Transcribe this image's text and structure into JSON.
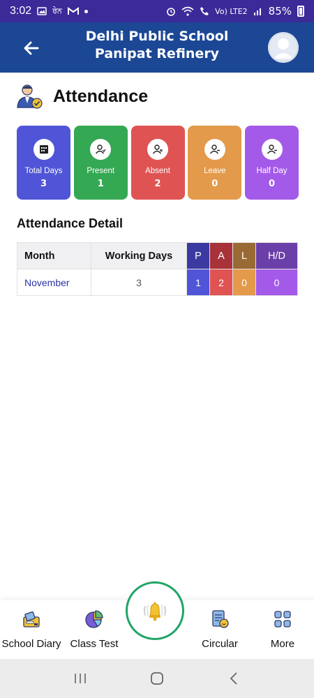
{
  "status_bar": {
    "time": "3:02",
    "carrier_text": "ਰੇਨ",
    "network_text": "Vo) LTE2",
    "battery": "85%"
  },
  "header": {
    "title": "Delhi Public School Panipat Refinery",
    "background": "#1b4795"
  },
  "page": {
    "title": "Attendance",
    "icon": "teacher-check-icon"
  },
  "stats": [
    {
      "label": "Total Days",
      "value": "3",
      "color": "#4f55d6",
      "icon": "calendar-icon"
    },
    {
      "label": "Present",
      "value": "1",
      "color": "#34a853",
      "icon": "user-present-icon"
    },
    {
      "label": "Absent",
      "value": "2",
      "color": "#e05353",
      "icon": "user-absent-icon"
    },
    {
      "label": "Leave",
      "value": "0",
      "color": "#e39a4a",
      "icon": "user-leave-icon"
    },
    {
      "label": "Half Day",
      "value": "0",
      "color": "#a45ae8",
      "icon": "user-halfday-icon"
    }
  ],
  "detail": {
    "title": "Attendance Detail",
    "headers": [
      "Month",
      "Working Days",
      "P",
      "A",
      "L",
      "H/D"
    ],
    "header_colors": {
      "P": "#3a3aa0",
      "A": "#a8323a",
      "L": "#9a6a35",
      "H/D": "#6a3fa8"
    },
    "row_colors": {
      "P": "#4f55d6",
      "A": "#e05353",
      "L": "#e39a4a",
      "H/D": "#a45ae8"
    },
    "rows": [
      {
        "month": "November",
        "working_days": "3",
        "p": "1",
        "a": "2",
        "l": "0",
        "hd": "0"
      }
    ]
  },
  "bottom_nav": {
    "items": [
      {
        "label": "School Diary",
        "icon": "diary-icon"
      },
      {
        "label": "Class Test",
        "icon": "pie-chart-icon"
      },
      {
        "label": "Circular",
        "icon": "circular-doc-icon"
      },
      {
        "label": "More",
        "icon": "grid-icon"
      }
    ],
    "center_icon": "bell-icon",
    "accent": "#1fa466"
  }
}
